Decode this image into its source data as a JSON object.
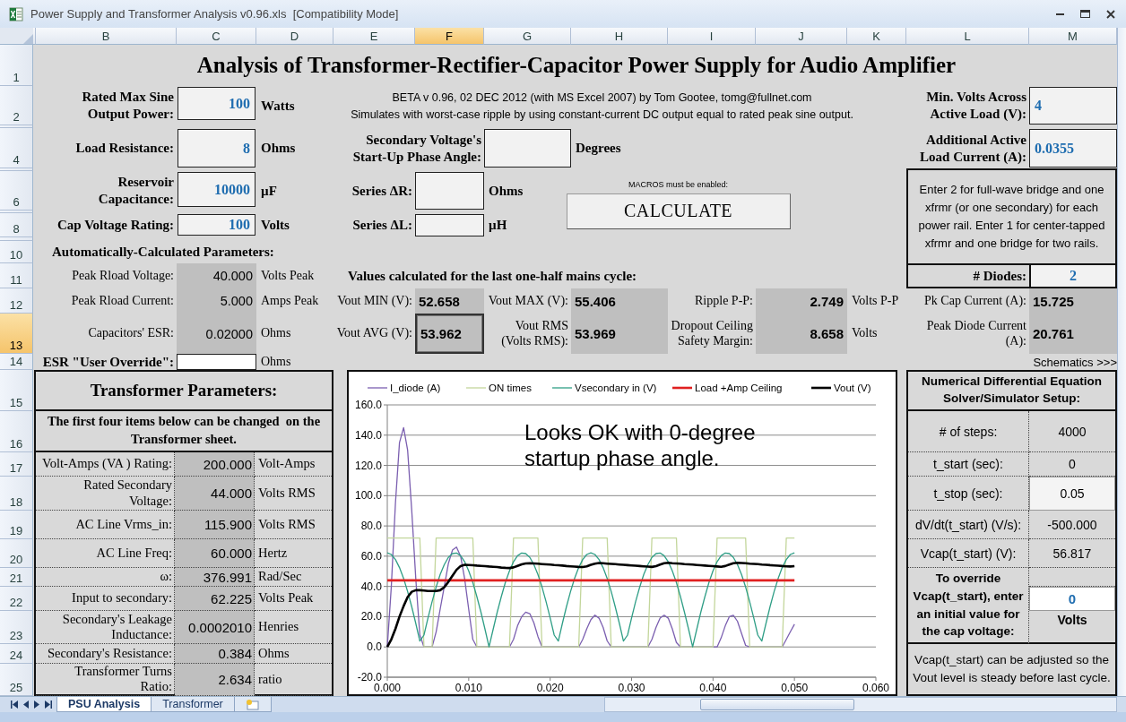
{
  "window": {
    "title": "Power Supply and Transformer Analysis v0.96.xls  [Compatibility Mode]"
  },
  "column_headers": [
    {
      "label": "B",
      "selected": false
    },
    {
      "label": "C",
      "selected": false
    },
    {
      "label": "D",
      "selected": false
    },
    {
      "label": "E",
      "selected": false
    },
    {
      "label": "F",
      "selected": true
    },
    {
      "label": "G",
      "selected": false
    },
    {
      "label": "H",
      "selected": false
    },
    {
      "label": "I",
      "selected": false
    },
    {
      "label": "J",
      "selected": false
    },
    {
      "label": "K",
      "selected": false
    },
    {
      "label": "L",
      "selected": false
    },
    {
      "label": "M",
      "selected": false
    }
  ],
  "row_headers": [
    {
      "label": "1",
      "selected": false
    },
    {
      "label": "2",
      "selected": false
    },
    {
      "label": "4",
      "selected": false
    },
    {
      "label": "6",
      "selected": false
    },
    {
      "label": "8",
      "selected": false
    },
    {
      "label": "10",
      "selected": false
    },
    {
      "label": "11",
      "selected": false
    },
    {
      "label": "12",
      "selected": false
    },
    {
      "label": "13",
      "selected": true
    },
    {
      "label": "14",
      "selected": false
    },
    {
      "label": "15",
      "selected": false
    },
    {
      "label": "16",
      "selected": false
    },
    {
      "label": "17",
      "selected": false
    },
    {
      "label": "18",
      "selected": false
    },
    {
      "label": "19",
      "selected": false
    },
    {
      "label": "20",
      "selected": false
    },
    {
      "label": "21",
      "selected": false
    },
    {
      "label": "22",
      "selected": false
    },
    {
      "label": "23",
      "selected": false
    },
    {
      "label": "24",
      "selected": false
    },
    {
      "label": "25",
      "selected": false
    }
  ],
  "sheet": {
    "title": "Analysis of Transformer-Rectifier-Capacitor Power Supply for Audio Amplifier",
    "inputs": [
      {
        "label": "Rated Max Sine Output Power:",
        "value": "100",
        "unit": "Watts"
      },
      {
        "label": "Load Resistance:",
        "value": "8",
        "unit": "Ohms"
      },
      {
        "label": "Reservoir Capacitance:",
        "value": "10000",
        "unit": "µF"
      },
      {
        "label": "Cap Voltage Rating:",
        "value": "100",
        "unit": "Volts"
      }
    ],
    "info_lines": [
      "BETA v 0.96, 02 DEC 2012 (with MS Excel 2007) by Tom Gootee, tomg@fullnet.com",
      "Simulates with worst-case ripple by using constant-current DC output equal to rated peak sine output."
    ],
    "phase_inputs": [
      {
        "label": "Secondary Voltage's Start-Up Phase Angle:",
        "unit": "Degrees"
      },
      {
        "label": "Series ΔR:",
        "unit": "Ohms"
      },
      {
        "label": "Series ΔL:",
        "unit": "µH"
      }
    ],
    "macros_note": "MACROS must be enabled:",
    "calculate_button": "CALCULATE",
    "right_inputs": [
      {
        "label": "Min. Volts Across Active Load (V):",
        "value": "4"
      },
      {
        "label": "Additional Active Load Current  (A):",
        "value": "0.0355"
      }
    ],
    "diode_note": "Enter 2 for full-wave bridge and one xfrmr (or one secondary) for each power rail. Enter 1 for center-tapped xfrmr and one bridge for two rails.",
    "diodes": {
      "label": "# Diodes:",
      "value": "2"
    },
    "auto_heading": "Automatically-Calculated Parameters:",
    "auto_params": [
      {
        "label": "Peak Rload Voltage:",
        "value": "40.000",
        "unit": "Volts Peak"
      },
      {
        "label": "Peak Rload Current:",
        "value": "5.000",
        "unit": "Amps Peak"
      },
      {
        "label": "Capacitors' ESR:",
        "value": "0.02000",
        "unit": "Ohms"
      }
    ],
    "esr_override": {
      "label": "ESR \"User Override\":",
      "unit": "Ohms"
    },
    "results_heading": "Values calculated for the last one-half mains cycle:",
    "results": [
      {
        "label": "Vout MIN (V):",
        "value": "52.658",
        "selected": false
      },
      {
        "label": "Vout MAX (V):",
        "value": "55.406",
        "selected": false
      },
      {
        "label": "Ripple P-P:",
        "value": "2.749",
        "unit": "Volts P-P",
        "selected": false
      },
      {
        "label": "Pk Cap Current (A):",
        "value": "15.725",
        "selected": false
      },
      {
        "label": "Vout AVG (V):",
        "value": "53.962",
        "selected": true
      },
      {
        "label": "Vout RMS (Volts RMS):",
        "value": "53.969",
        "selected": false
      },
      {
        "label": "Dropout Ceiling Safety Margin:",
        "value": "8.658",
        "unit": "Volts",
        "selected": false
      },
      {
        "label": "Peak Diode Current (A):",
        "value": "20.761",
        "selected": false
      }
    ],
    "schematics_link": "Schematics >>>",
    "transformer": {
      "title": "Transformer Parameters:",
      "note": "The first four items below can be changed  on the Transformer sheet.",
      "rows": [
        {
          "label": "Volt-Amps (VA ) Rating:",
          "value": "200.000",
          "unit": "Volt-Amps"
        },
        {
          "label": "Rated Secondary Voltage:",
          "value": "44.000",
          "unit": "Volts RMS"
        },
        {
          "label": "AC Line Vrms_in:",
          "value": "115.900",
          "unit": "Volts RMS"
        },
        {
          "label": "AC Line Freq:",
          "value": "60.000",
          "unit": "Hertz"
        },
        {
          "label": "ω:",
          "value": "376.991",
          "unit": "Rad/Sec"
        },
        {
          "label": "Input to secondary:",
          "value": "62.225",
          "unit": "Volts Peak"
        },
        {
          "label": "Secondary's Leakage Inductance:",
          "value": "0.0002010",
          "unit": "Henries"
        },
        {
          "label": "Secondary's Resistance:",
          "value": "0.384",
          "unit": "Ohms"
        },
        {
          "label": "Transformer Turns Ratio:",
          "value": "2.634",
          "unit": "ratio"
        }
      ]
    },
    "solver": {
      "title": "Numerical Differential Equation Solver/Simulator Setup:",
      "rows": [
        {
          "label": "# of steps:",
          "value": "4000",
          "editable": false
        },
        {
          "label": "t_start (sec):",
          "value": "0",
          "editable": false
        },
        {
          "label": "t_stop (sec):",
          "value": "0.05",
          "editable": true
        },
        {
          "label": "dV/dt(t_start) (V/s):",
          "value": "-500.000",
          "editable": false
        },
        {
          "label": "Vcap(t_start) (V):",
          "value": "56.817",
          "editable": false
        }
      ],
      "override": {
        "label": "To override Vcap(t_start), enter an initial value for the cap voltage:",
        "value": "0",
        "unit": "Volts"
      },
      "note": "Vcap(t_start) can be adjusted so the Vout level is steady before last cycle."
    },
    "chart": {
      "chart_data": {
        "type": "line",
        "x": [
          0,
          0.0005,
          0.001,
          0.0015,
          0.002,
          0.0025,
          0.003,
          0.0035,
          0.004,
          0.0045,
          0.005,
          0.0055,
          0.006,
          0.0065,
          0.007,
          0.0075,
          0.008,
          0.0085,
          0.009,
          0.0095,
          0.01,
          0.0105,
          0.011,
          0.0115,
          0.012,
          0.0125,
          0.013,
          0.0135,
          0.014,
          0.0145,
          0.015,
          0.0155,
          0.016,
          0.0165,
          0.017,
          0.0175,
          0.018,
          0.0185,
          0.019,
          0.0195,
          0.02,
          0.0205,
          0.021,
          0.0215,
          0.022,
          0.0225,
          0.023,
          0.0235,
          0.024,
          0.0245,
          0.025,
          0.0255,
          0.026,
          0.0265,
          0.027,
          0.0275,
          0.028,
          0.0285,
          0.029,
          0.0295,
          0.03,
          0.0305,
          0.031,
          0.0315,
          0.032,
          0.0325,
          0.033,
          0.0335,
          0.034,
          0.0345,
          0.035,
          0.0355,
          0.036,
          0.0365,
          0.037,
          0.0375,
          0.038,
          0.0385,
          0.039,
          0.0395,
          0.04,
          0.0405,
          0.041,
          0.0415,
          0.042,
          0.0425,
          0.043,
          0.0435,
          0.044,
          0.0445,
          0.045,
          0.0455,
          0.046,
          0.0465,
          0.047,
          0.0475,
          0.048,
          0.0485,
          0.049,
          0.0495,
          0.05
        ],
        "series": [
          {
            "name": "I_diode (A)",
            "color": "#7b5fb0",
            "values": [
              0,
              40,
              95,
              135,
              145,
              130,
              90,
              45,
              8,
              0,
              0,
              0,
              10,
              25,
              40,
              55,
              64,
              66,
              60,
              45,
              25,
              5,
              0,
              0,
              0,
              0,
              0,
              0,
              0,
              0,
              0,
              5,
              14,
              20,
              23,
              22,
              16,
              7,
              0,
              0,
              0,
              0,
              0,
              0,
              0,
              0,
              0,
              0,
              5,
              12,
              18,
              21,
              19,
              13,
              4,
              0,
              0,
              0,
              0,
              0,
              0,
              0,
              0,
              0,
              0,
              5,
              13,
              19,
              21,
              19,
              12,
              3,
              0,
              0,
              0,
              0,
              0,
              0,
              0,
              0,
              0,
              0,
              6,
              14,
              20,
              21,
              17,
              9,
              1,
              0,
              0,
              0,
              0,
              0,
              0,
              0,
              0,
              0,
              5,
              10,
              15
            ]
          },
          {
            "name": "ON times",
            "color": "#c3d69b",
            "values": [
              72,
              72,
              72,
              72,
              72,
              72,
              72,
              72,
              72,
              0,
              0,
              0,
              72,
              72,
              72,
              72,
              72,
              72,
              72,
              72,
              72,
              72,
              0,
              0,
              0,
              0,
              0,
              0,
              0,
              0,
              0,
              72,
              72,
              72,
              72,
              72,
              72,
              72,
              0,
              0,
              0,
              0,
              0,
              0,
              0,
              0,
              0,
              0,
              72,
              72,
              72,
              72,
              72,
              72,
              72,
              0,
              0,
              0,
              0,
              0,
              0,
              0,
              0,
              0,
              0,
              72,
              72,
              72,
              72,
              72,
              72,
              72,
              0,
              0,
              0,
              0,
              0,
              0,
              0,
              0,
              0,
              72,
              72,
              72,
              72,
              72,
              72,
              72,
              72,
              0,
              0,
              0,
              0,
              0,
              0,
              0,
              0,
              0,
              72,
              72,
              72
            ]
          },
          {
            "name": "Vsecondary in (V)",
            "color": "#2f9e86",
            "values": [
              62.2,
              61.1,
              57.8,
              52.5,
              45.3,
              36.6,
              26.5,
              15.5,
              3.9,
              7.8,
              19.2,
              30.0,
              39.6,
              47.9,
              54.5,
              59.2,
              61.7,
              62.1,
              60.3,
              56.3,
              50.3,
              42.6,
              33.3,
              22.9,
              11.7,
              0.0,
              11.7,
              22.9,
              33.3,
              42.6,
              50.3,
              56.3,
              60.3,
              62.1,
              61.7,
              59.2,
              54.5,
              47.9,
              39.6,
              30.0,
              19.2,
              7.8,
              3.9,
              15.5,
              26.5,
              36.6,
              45.3,
              52.5,
              57.8,
              61.1,
              62.2,
              61.1,
              57.8,
              52.5,
              45.3,
              36.6,
              26.5,
              15.5,
              3.9,
              7.8,
              19.2,
              30.0,
              39.6,
              47.9,
              54.5,
              59.2,
              61.7,
              62.1,
              60.3,
              56.3,
              50.3,
              42.6,
              33.3,
              22.9,
              11.7,
              0.0,
              11.7,
              22.9,
              33.3,
              42.6,
              50.3,
              56.3,
              60.3,
              62.1,
              61.7,
              59.2,
              54.5,
              47.9,
              39.6,
              30.0,
              19.2,
              7.8,
              3.9,
              15.5,
              26.5,
              36.6,
              45.3,
              52.5,
              57.8,
              61.1,
              62.2
            ]
          },
          {
            "name": "Load +Amp Ceiling",
            "color": "#e02020",
            "values": [
              44,
              44,
              44,
              44,
              44,
              44,
              44,
              44,
              44,
              44,
              44,
              44,
              44,
              44,
              44,
              44,
              44,
              44,
              44,
              44,
              44,
              44,
              44,
              44,
              44,
              44,
              44,
              44,
              44,
              44,
              44,
              44,
              44,
              44,
              44,
              44,
              44,
              44,
              44,
              44,
              44,
              44,
              44,
              44,
              44,
              44,
              44,
              44,
              44,
              44,
              44,
              44,
              44,
              44,
              44,
              44,
              44,
              44,
              44,
              44,
              44,
              44,
              44,
              44,
              44,
              44,
              44,
              44,
              44,
              44,
              44,
              44,
              44,
              44,
              44,
              44,
              44,
              44,
              44,
              44,
              44,
              44,
              44,
              44,
              44,
              44,
              44,
              44,
              44,
              44,
              44,
              44,
              44,
              44,
              44,
              44,
              44,
              44,
              44,
              44,
              44
            ]
          },
          {
            "name": "Vout (V)",
            "color": "#000000",
            "values": [
              0,
              5,
              12,
              20,
              27,
              33,
              36.5,
              37.5,
              37.5,
              37.3,
              37,
              37,
              37,
              37.5,
              39.5,
              43,
              47,
              51,
              53.5,
              54.3,
              54.2,
              54,
              53.8,
              53.6,
              53.4,
              53.2,
              53,
              52.8,
              52.5,
              52.3,
              52.2,
              52.6,
              53.6,
              54.6,
              55.2,
              55.4,
              55.2,
              55,
              54.8,
              54.6,
              54.4,
              54.2,
              54,
              53.8,
              53.5,
              53.3,
              53.1,
              52.9,
              52.8,
              53.3,
              54.3,
              55.1,
              55.5,
              55.3,
              55.1,
              54.9,
              54.7,
              54.5,
              54.3,
              54.1,
              53.9,
              53.7,
              53.5,
              53.3,
              53.1,
              52.9,
              53.4,
              54.4,
              55.3,
              55.6,
              55.4,
              55.2,
              55,
              54.8,
              54.6,
              54.4,
              54.2,
              54,
              53.8,
              53.6,
              53.4,
              53.2,
              53,
              53.5,
              54.5,
              55.4,
              55.7,
              55.5,
              55.3,
              55.1,
              54.9,
              54.7,
              54.5,
              54.3,
              54.1,
              53.9,
              53.7,
              53.5,
              53.3,
              53.2,
              53.4
            ]
          }
        ],
        "xlim": [
          0,
          0.06
        ],
        "ylim": [
          -20,
          160
        ],
        "xticks": [
          {
            "value": 0,
            "label": "0.000"
          },
          {
            "value": 0.01,
            "label": "0.010"
          },
          {
            "value": 0.02,
            "label": "0.020"
          },
          {
            "value": 0.03,
            "label": "0.030"
          },
          {
            "value": 0.04,
            "label": "0.040"
          },
          {
            "value": 0.05,
            "label": "0.050"
          },
          {
            "value": 0.06,
            "label": "0.060"
          }
        ],
        "yticks": [
          {
            "value": -20,
            "label": "-20.0"
          },
          {
            "value": 0,
            "label": "0.0"
          },
          {
            "value": 20,
            "label": "20.0"
          },
          {
            "value": 40,
            "label": "40.0"
          },
          {
            "value": 60,
            "label": "60.0"
          },
          {
            "value": 80,
            "label": "80.0"
          },
          {
            "value": 100,
            "label": "100.0"
          },
          {
            "value": 120,
            "label": "120.0"
          },
          {
            "value": 140,
            "label": "140.0"
          },
          {
            "value": 160,
            "label": "160.0"
          }
        ],
        "grid": true,
        "legend": "top",
        "annotations": [
          "Looks OK with 0-degree startup phase angle."
        ]
      }
    }
  },
  "sheet_tabs": [
    {
      "label": "PSU Analysis",
      "selected": true
    },
    {
      "label": "Transformer",
      "selected": false
    }
  ]
}
